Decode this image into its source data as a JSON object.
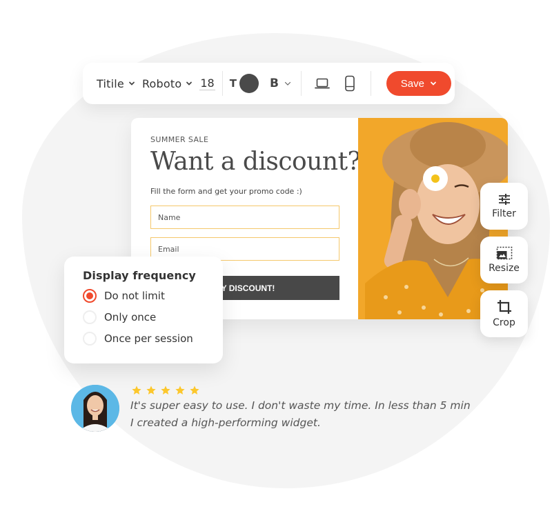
{
  "toolbar": {
    "element_type": "Titile",
    "font_family": "Roboto",
    "font_size": "18",
    "text_color_label": "T",
    "text_color": "#4a4a4a",
    "bold_label": "B",
    "device_desktop_icon": "laptop-icon",
    "device_mobile_icon": "mobile-icon",
    "save_label": "Save"
  },
  "popup": {
    "eyebrow": "SUMMER SALE",
    "headline": "Want a discount?",
    "subtext": "Fill the form and get your promo code :)",
    "name_placeholder": "Name",
    "email_placeholder": "Email",
    "cta_label": "GET MY DISCOUNT!",
    "cta_visible_label": "MY DISCOUNT!",
    "image_bg_color": "#f2a72a"
  },
  "side_tools": [
    {
      "label": "Filter",
      "icon": "sliders-icon"
    },
    {
      "label": "Resize",
      "icon": "resize-image-icon"
    },
    {
      "label": "Crop",
      "icon": "crop-icon"
    }
  ],
  "display_frequency": {
    "title": "Display frequency",
    "options": [
      {
        "label": "Do not limit",
        "selected": true
      },
      {
        "label": "Only once",
        "selected": false
      },
      {
        "label": "Once per session",
        "selected": false
      }
    ]
  },
  "testimonial": {
    "rating": 5,
    "rating_max": 5,
    "quote": "It's super easy to use. I don't waste my time. In less than 5 min I created a high-performing widget."
  },
  "colors": {
    "accent": "#f04a2d",
    "star": "#fcc72c",
    "field_border": "#f5c76a"
  }
}
